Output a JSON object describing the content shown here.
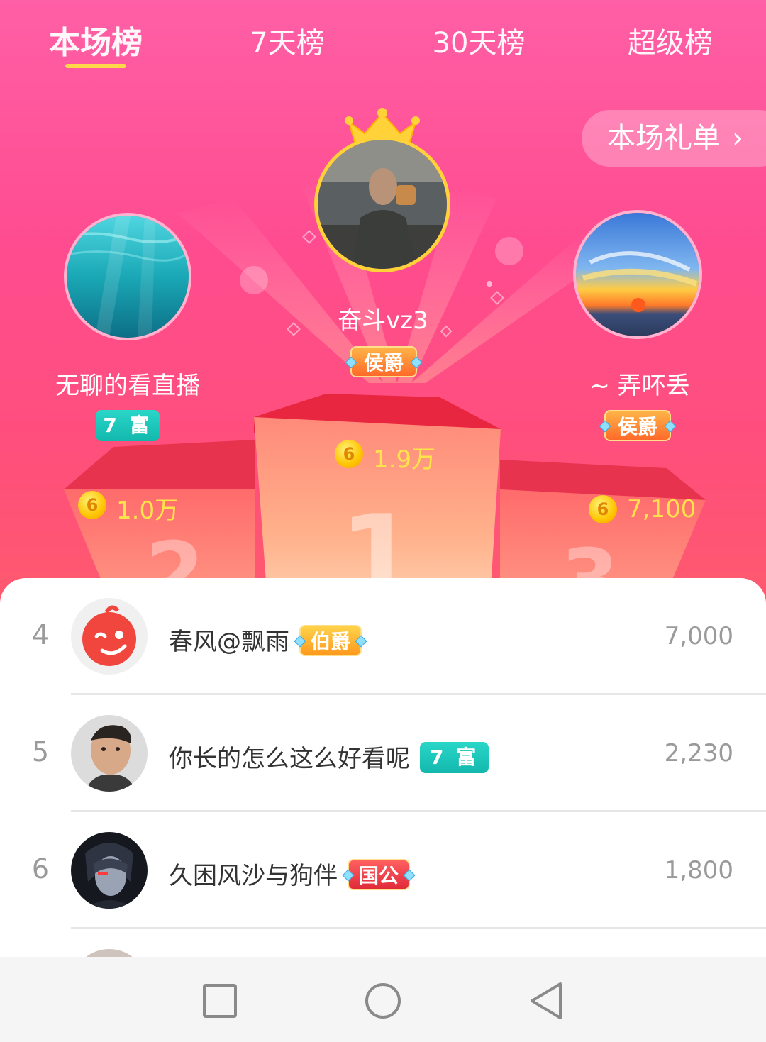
{
  "tabs": [
    {
      "label": "本场榜",
      "active": true
    },
    {
      "label": "7天榜",
      "active": false
    },
    {
      "label": "30天榜",
      "active": false
    },
    {
      "label": "超级榜",
      "active": false
    }
  ],
  "gift_list": {
    "label": "本场礼单",
    "icon": "chevron-right-icon"
  },
  "podium": {
    "first": {
      "rank": "1",
      "name": "奋斗vz3",
      "badge": "侯爵",
      "amount": "1.9万",
      "coin_label": "6"
    },
    "second": {
      "rank": "2",
      "name": "无聊的看直播",
      "badge": "7 富",
      "amount": "1.0万",
      "coin_label": "6"
    },
    "third": {
      "rank": "3",
      "name": "~ 弄吥丢",
      "badge": "侯爵",
      "amount": "7,100",
      "coin_label": "6"
    }
  },
  "list": [
    {
      "rank": "4",
      "name": "春风@飘雨",
      "badge": "伯爵",
      "value": "7,000"
    },
    {
      "rank": "5",
      "name": "你长的怎么这么好看呢",
      "badge": "7 富",
      "value": "2,230"
    },
    {
      "rank": "6",
      "name": "久困风沙与狗伴",
      "badge": "国公",
      "value": "1,800"
    }
  ],
  "colors": {
    "hero_top": "#ff5fa6",
    "hero_bottom": "#ff5a6e",
    "tab_underline": "#ffd84a",
    "amount": "#ffe34a",
    "rich_badge": "#13b8ad"
  },
  "navbar": {
    "icons": [
      "recents-square-icon",
      "home-circle-icon",
      "back-triangle-icon"
    ]
  }
}
